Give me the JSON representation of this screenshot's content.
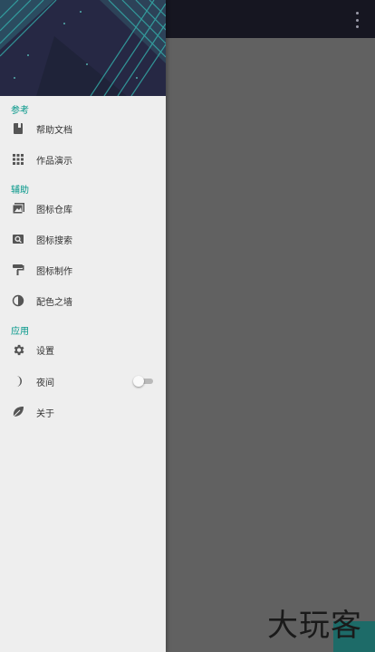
{
  "topbar": {
    "overflow_icon": "more-vert-icon"
  },
  "drawer": {
    "sections": [
      {
        "label": "参考",
        "items": [
          {
            "label": "帮助文档",
            "icon": "book-icon"
          },
          {
            "label": "作品演示",
            "icon": "grid-icon"
          }
        ]
      },
      {
        "label": "辅助",
        "items": [
          {
            "label": "图标仓库",
            "icon": "image-library-icon"
          },
          {
            "label": "图标搜索",
            "icon": "image-search-icon"
          },
          {
            "label": "图标制作",
            "icon": "paint-roller-icon"
          },
          {
            "label": "配色之墙",
            "icon": "contrast-icon"
          }
        ]
      },
      {
        "label": "应用",
        "items": [
          {
            "label": "设置",
            "icon": "gear-icon"
          },
          {
            "label": "夜间",
            "icon": "moon-icon",
            "toggle": false
          },
          {
            "label": "关于",
            "icon": "leaf-icon"
          }
        ]
      }
    ]
  },
  "watermark": "大玩客",
  "colors": {
    "accent": "#009688",
    "drawer_bg": "#eeeeee",
    "scrim": "#616161",
    "toolbar": "#161621"
  }
}
